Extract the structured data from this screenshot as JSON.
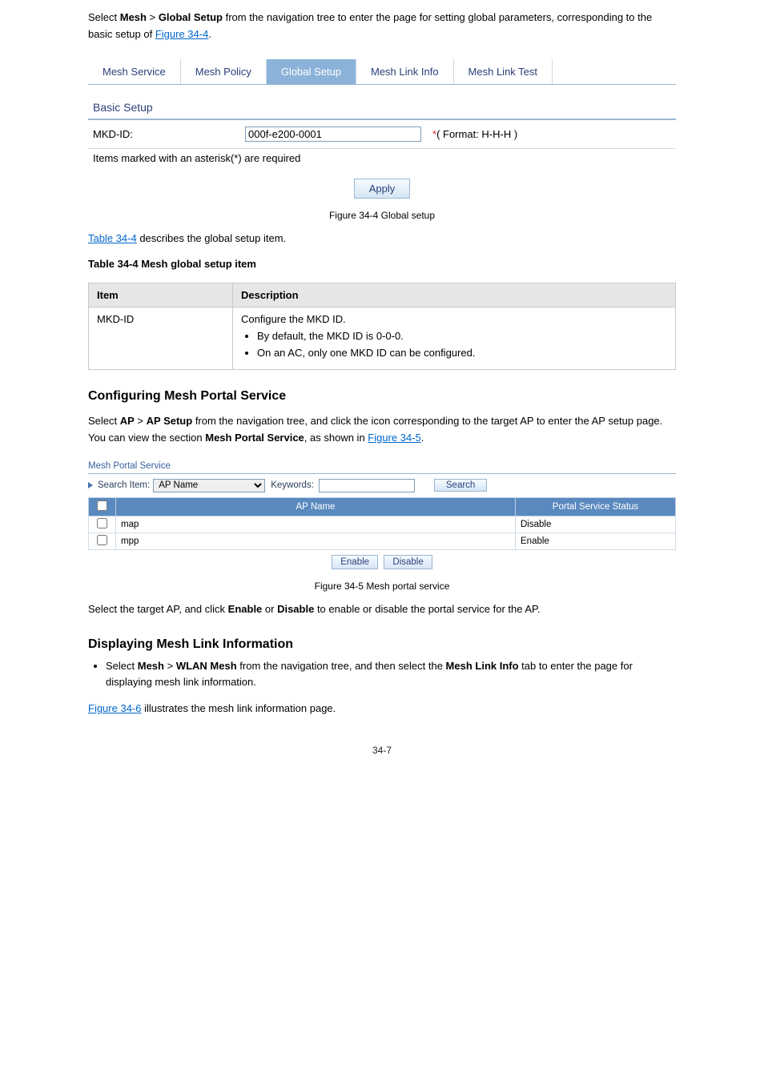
{
  "intro1_prefix": "Select ",
  "intro1_bold1": "Mesh",
  "intro1_mid": " > ",
  "intro1_bold2": "Global Setup",
  "intro1_rest": " from the navigation tree to enter the page for setting global parameters, corresponding to the basic setup of ",
  "intro1_figref": "Figure 34-4",
  "intro1_after": ".",
  "fig1": {
    "tabs": [
      "Mesh Service",
      "Mesh Policy",
      "Global Setup",
      "Mesh Link Info",
      "Mesh Link Test"
    ],
    "active_tab_index": 2,
    "section_title": "Basic Setup",
    "field_label": "MKD-ID:",
    "field_value": "000f-e200-0001",
    "field_hint_star": "*",
    "field_hint_text": "( Format: H-H-H )",
    "required_note": "Items marked with an asterisk(*) are required",
    "apply_label": "Apply"
  },
  "fig1_caption": "Figure 34-4 Global setup",
  "table_link": "Table 34-4",
  "table_intro_rest": " describes the global setup item.",
  "table_caption": "Table 34-4 Mesh global setup item",
  "item_table": {
    "headers": [
      "Item",
      "Description"
    ],
    "row_item": "MKD-ID",
    "row_desc_p": "Configure the MKD ID.",
    "row_desc_b1": "By default, the MKD ID is 0-0-0.",
    "row_desc_b2": "On an AC, only one MKD ID can be configured."
  },
  "h_mps": "Configuring Mesh Portal Service",
  "mps_text_prefix": "Select ",
  "mps_bold1": "AP",
  "mps_mid1": " > ",
  "mps_bold2": "AP Setup",
  "mps_rest1": " from the navigation tree, and click the icon corresponding to the target AP to enter the AP setup page. You can view the section ",
  "mps_bold3": "Mesh Portal Service",
  "mps_rest2": ", as shown in ",
  "mps_figref": "Figure 34-5",
  "mps_after": ".",
  "fig2": {
    "section_title": "Mesh Portal Service",
    "search_label": "Search Item:",
    "search_select": "AP Name",
    "keywords_label": "Keywords:",
    "keywords_value": "",
    "search_btn": "Search",
    "col_apname": "AP Name",
    "col_status": "Portal Service Status",
    "rows": [
      {
        "ap": "map",
        "status": "Disable"
      },
      {
        "ap": "mpp",
        "status": "Enable"
      }
    ],
    "enable_btn": "Enable",
    "disable_btn": "Disable"
  },
  "fig2_caption": "Figure 34-5 Mesh portal service",
  "after_fig2_p1a": "Select the target AP, and click ",
  "after_fig2_b1": "Enable",
  "after_fig2_p1b": " or ",
  "after_fig2_b2": "Disable",
  "after_fig2_p1c": " to enable or disable the portal service for the AP.",
  "h_display": "Displaying Mesh Link Information",
  "display_b1_p1": "Select ",
  "display_b1_b1": "Mesh",
  "display_b1_mid": " > ",
  "display_b1_b2": "WLAN Mesh",
  "display_b1_p2": " from the navigation tree, and then select the ",
  "display_b1_b3": "Mesh Link Info",
  "display_b1_p3": " tab to enter the page for displaying mesh link information.",
  "fig3_ref_prefix": "",
  "fig3_ref": "Figure 34-6",
  "fig3_ref_rest": " illustrates the mesh link information page.",
  "page_number": "34-7"
}
